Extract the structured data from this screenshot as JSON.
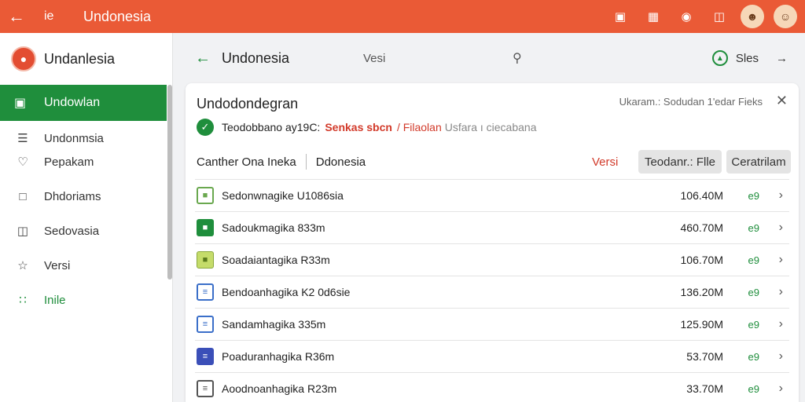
{
  "topbar": {
    "back_icon": "arrow-left-icon",
    "app_short": "ie",
    "title": "Undonesia",
    "icons": [
      "screenshot-icon",
      "chart-icon",
      "notification-icon",
      "inbox-icon",
      "avatar-icon",
      "profile-icon"
    ]
  },
  "sidebar": {
    "title": "Undanlesia",
    "active": {
      "label": "Undowlan",
      "icon": "image-icon"
    },
    "items": [
      {
        "label": "Undonmsia",
        "icon": "menu-icon"
      },
      {
        "label": "Pepakam",
        "icon": "bell-icon"
      },
      {
        "label": "Dhdoriams",
        "icon": "download-icon"
      },
      {
        "label": "Sedovasia",
        "icon": "inbox-icon"
      },
      {
        "label": "Versi",
        "icon": "star-icon"
      },
      {
        "label": "Inile",
        "icon": "grid-icon"
      }
    ]
  },
  "main_header": {
    "title": "Undonesia",
    "middle": "Vesi",
    "right_label": "Sles"
  },
  "card": {
    "title": "Undodondegran",
    "meta": "Ukaram.: Sodudan 1'edar Fieks",
    "status": {
      "text": "Teodobbano ay19C:",
      "highlight": "Senkas sbcn",
      "link": "/ Filaolan",
      "tail": "Usfara ı ciecabana"
    },
    "toolbar": {
      "label": "Canther Ona Ineka",
      "sub": "Ddonesia",
      "red": "Versi",
      "btn1": "Teodanr.: Flle",
      "btn2": "Ceratrilam"
    },
    "files": [
      {
        "name": "Sedonwnagike U1086sia",
        "size": "106.40M",
        "status": "e9",
        "icon": "box-icon",
        "color": "#6aa84f"
      },
      {
        "name": "Sadoukmagika 833m",
        "size": "460.70M",
        "status": "e9",
        "icon": "green-file-icon",
        "color": "#1f8e3c"
      },
      {
        "name": "Soadaiantagika R33m",
        "size": "106.70M",
        "status": "e9",
        "icon": "box-icon",
        "color": "#9bbb3c"
      },
      {
        "name": "Bendoanhagika K2 0d6sie",
        "size": "136.20M",
        "status": "e9",
        "icon": "doc-icon",
        "color": "#3b6fc9"
      },
      {
        "name": "Sandamhagika 335m",
        "size": "125.90M",
        "status": "e9",
        "icon": "doc-icon",
        "color": "#3b6fc9"
      },
      {
        "name": "Poaduranhagika R36m",
        "size": "53.70M",
        "status": "e9",
        "icon": "doc-icon",
        "color": "#3b4fb8"
      },
      {
        "name": "Aoodnoanhagika R23m",
        "size": "33.70M",
        "status": "e9",
        "icon": "doc-icon",
        "color": "#555555"
      }
    ]
  },
  "colors": {
    "accent": "#ea5a36",
    "green": "#1f8e3c",
    "red": "#d23a2a"
  }
}
